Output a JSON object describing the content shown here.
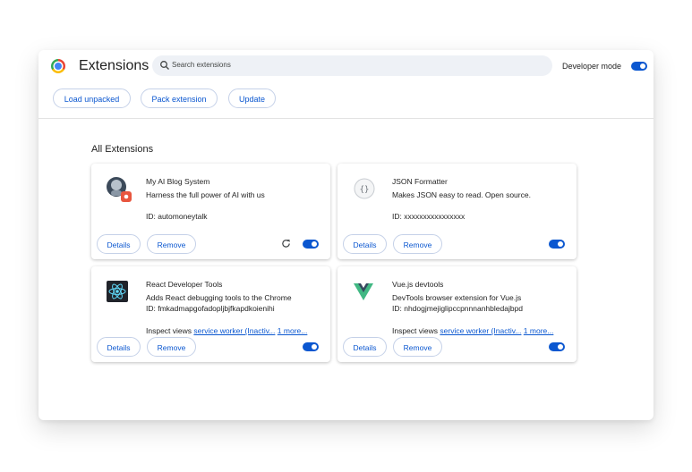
{
  "header": {
    "title": "Extensions",
    "search_placeholder": "Search extensions",
    "developer_mode_label": "Developer mode",
    "developer_mode_on": true
  },
  "toolbar": {
    "load_unpacked": "Load unpacked",
    "pack_extension": "Pack extension",
    "update": "Update"
  },
  "section_title": "All Extensions",
  "extensions": [
    {
      "name": "My AI Blog System",
      "description": "Harness the full power of AI with us",
      "id_text": "ID: automoneytalk",
      "details": "Details",
      "remove": "Remove",
      "enabled": true,
      "icon": "ai-robot-icon"
    },
    {
      "name": "JSON Formatter",
      "description": "Makes JSON easy to read. Open source.",
      "id_text": "ID: xxxxxxxxxxxxxxxx",
      "details": "Details",
      "remove": "Remove",
      "enabled": true,
      "icon": "json-formatter-icon"
    },
    {
      "name": "React Developer Tools",
      "description": "Adds React debugging tools to the Chrome",
      "id_text": "ID: fmkadmapgofadopljbjfkapdkoienihi",
      "inspect_label": "Inspect views",
      "inspect_link": "service worker (Inactiv...",
      "more_link": "1 more...",
      "details": "Details",
      "remove": "Remove",
      "enabled": true,
      "icon": "react-icon"
    },
    {
      "name": "Vue.js devtools",
      "description": "DevTools browser extension for Vue.js",
      "id_text": "ID: nhdogjmejiglipccpnnnanhbledajbpd",
      "inspect_label": "Inspect views",
      "inspect_link": "service worker (Inactiv...",
      "more_link": "1 more...",
      "details": "Details",
      "remove": "Remove",
      "enabled": true,
      "icon": "vue-icon"
    }
  ],
  "colors": {
    "accent": "#0b57d0",
    "border": "#c5d1e8",
    "search_bg": "#eef1f6"
  }
}
